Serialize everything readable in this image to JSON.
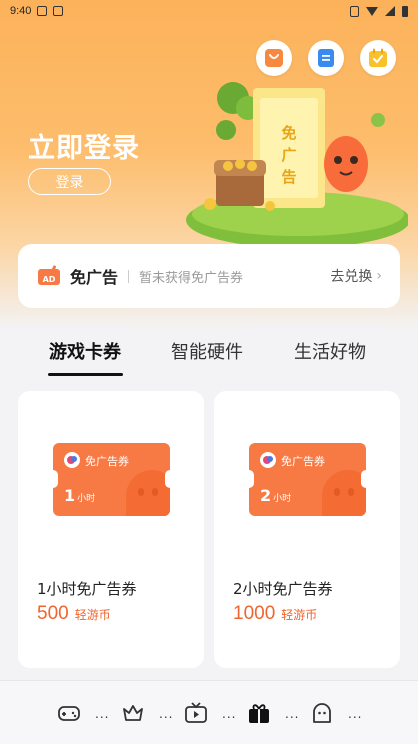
{
  "status_bar": {
    "time": "9:40"
  },
  "header": {
    "login_title": "立即登录",
    "login_button": "登录"
  },
  "top_icons": [
    "shop-icon",
    "notes-icon",
    "calendar-check-icon"
  ],
  "illustration": {
    "ticket_text": "免广告"
  },
  "ad_free_card": {
    "icon_text": "AD",
    "title": "免广告",
    "subtitle": "暂未获得免广告券",
    "link": "去兑换"
  },
  "tabs": [
    {
      "label": "游戏卡券",
      "active": true
    },
    {
      "label": "智能硬件",
      "active": false
    },
    {
      "label": "生活好物",
      "active": false
    }
  ],
  "products": [
    {
      "coupon_label": "免广告券",
      "coupon_hours": "1",
      "coupon_unit": "小时",
      "name": "1小时免广告券",
      "price": "500",
      "currency": "轻游币"
    },
    {
      "coupon_label": "免广告券",
      "coupon_hours": "2",
      "coupon_unit": "小时",
      "name": "2小时免广告券",
      "price": "1000",
      "currency": "轻游币"
    }
  ],
  "bottom_nav": {
    "items": [
      "gamepad-icon",
      "crown-icon",
      "tv-icon",
      "gift-icon",
      "ghost-icon"
    ],
    "active_index": 3,
    "separator": "..."
  },
  "colors": {
    "accent": "#f0642d",
    "coupon": "#f77a45",
    "hero_top": "#fcb25a"
  }
}
